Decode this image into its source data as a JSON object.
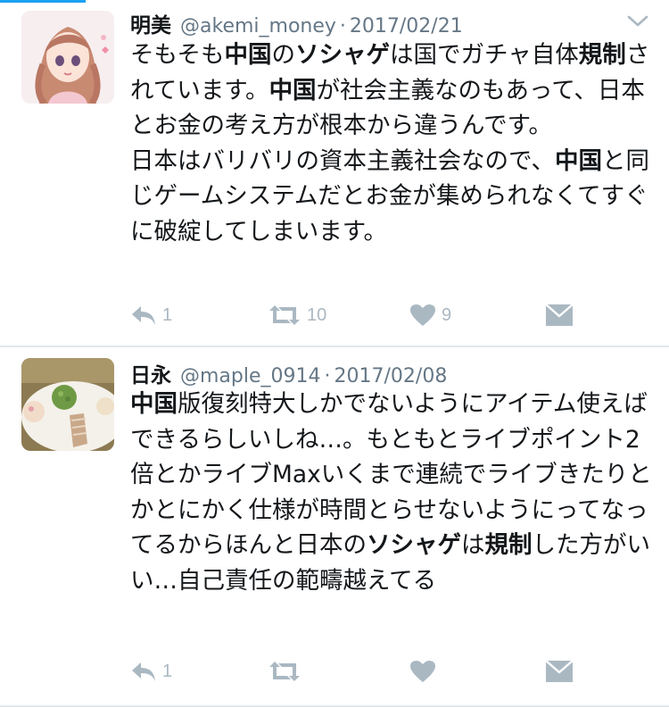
{
  "colors": {
    "accent": "#1da1f2",
    "text": "#14171a",
    "muted": "#657786",
    "icon": "#aab8c2",
    "divider": "#e1e8ed"
  },
  "tweets": [
    {
      "name": "明美",
      "handle": "@akemi_money",
      "separator": "·",
      "date": "2017/02/21",
      "avatar": "anime-girl-avatar",
      "body": [
        {
          "text": "そもそも",
          "bold": false
        },
        {
          "text": "中国",
          "bold": true
        },
        {
          "text": "の",
          "bold": false
        },
        {
          "text": "ソシャゲ",
          "bold": true
        },
        {
          "text": "は国でガチャ自体",
          "bold": false
        },
        {
          "text": "規制",
          "bold": true
        },
        {
          "text": "されています。",
          "bold": false
        },
        {
          "text": "中国",
          "bold": true
        },
        {
          "text": "が社会主義なのもあって、日本とお金の考え方が根本から違うんです。",
          "bold": false
        },
        {
          "text": "\n日本はバリバリの資本主義社会なので、",
          "bold": false
        },
        {
          "text": "中国",
          "bold": true
        },
        {
          "text": "と同じゲームシステムだとお金が集められなくてすぐに破綻してしまいます。",
          "bold": false
        }
      ],
      "actions": {
        "reply_icon": "reply-icon",
        "reply_count": "1",
        "retweet_icon": "retweet-icon",
        "retweet_count": "10",
        "like_icon": "heart-icon",
        "like_count": "9",
        "dm_icon": "direct-message-icon"
      }
    },
    {
      "name": "日永",
      "handle": "@maple_0914",
      "separator": "·",
      "date": "2017/02/08",
      "avatar": "sweets-photo-avatar",
      "body": [
        {
          "text": "中国",
          "bold": true
        },
        {
          "text": "版復刻特大しかでないようにアイテム使えばできるらしいしね…。もともとライブポイント2倍とかライブMaxいくまで連続でライブきたりとかとにかく仕様が時間とらせないようにってなってるからほんと日本の",
          "bold": false
        },
        {
          "text": "ソシャゲ",
          "bold": true
        },
        {
          "text": "は",
          "bold": false
        },
        {
          "text": "規制",
          "bold": true
        },
        {
          "text": "した方がいい…自己責任の範疇越えてる",
          "bold": false
        }
      ],
      "actions": {
        "reply_icon": "reply-icon",
        "reply_count": "1",
        "retweet_icon": "retweet-icon",
        "retweet_count": "",
        "like_icon": "heart-icon",
        "like_count": "",
        "dm_icon": "direct-message-icon"
      }
    }
  ]
}
